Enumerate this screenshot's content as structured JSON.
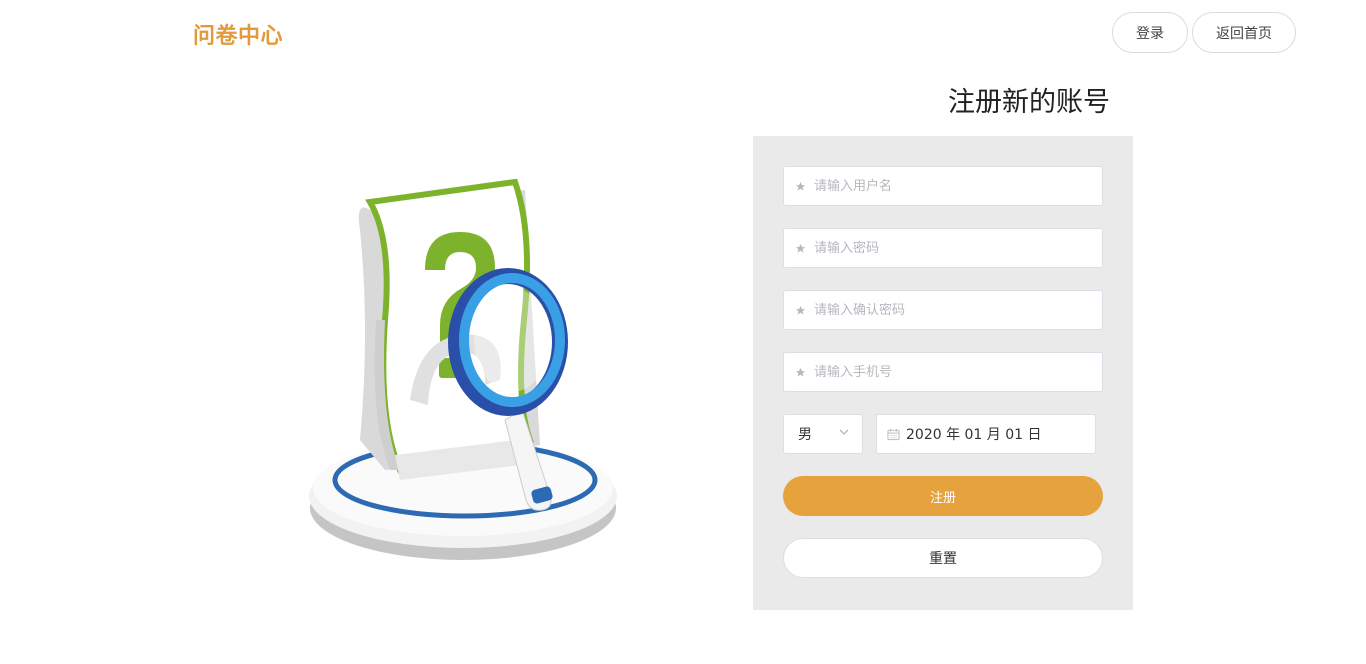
{
  "header": {
    "logo_text": "问卷中心",
    "login_label": "登录",
    "home_label": "返回首页"
  },
  "form": {
    "title": "注册新的账号",
    "username_placeholder": "请输入用户名",
    "password_placeholder": "请输入密码",
    "confirm_password_placeholder": "请输入确认密码",
    "phone_placeholder": "请输入手机号",
    "gender_value": "男",
    "date_value": "2020 年 01 月 01 日",
    "register_label": "注册",
    "reset_label": "重置"
  },
  "colors": {
    "accent": "#e6a23c",
    "logo": "#e39a3a",
    "panel_bg": "#ebeaea"
  },
  "icons": {
    "field_icon": "star-icon",
    "select_icon": "chevron-down-icon",
    "date_icon": "calendar-icon"
  }
}
